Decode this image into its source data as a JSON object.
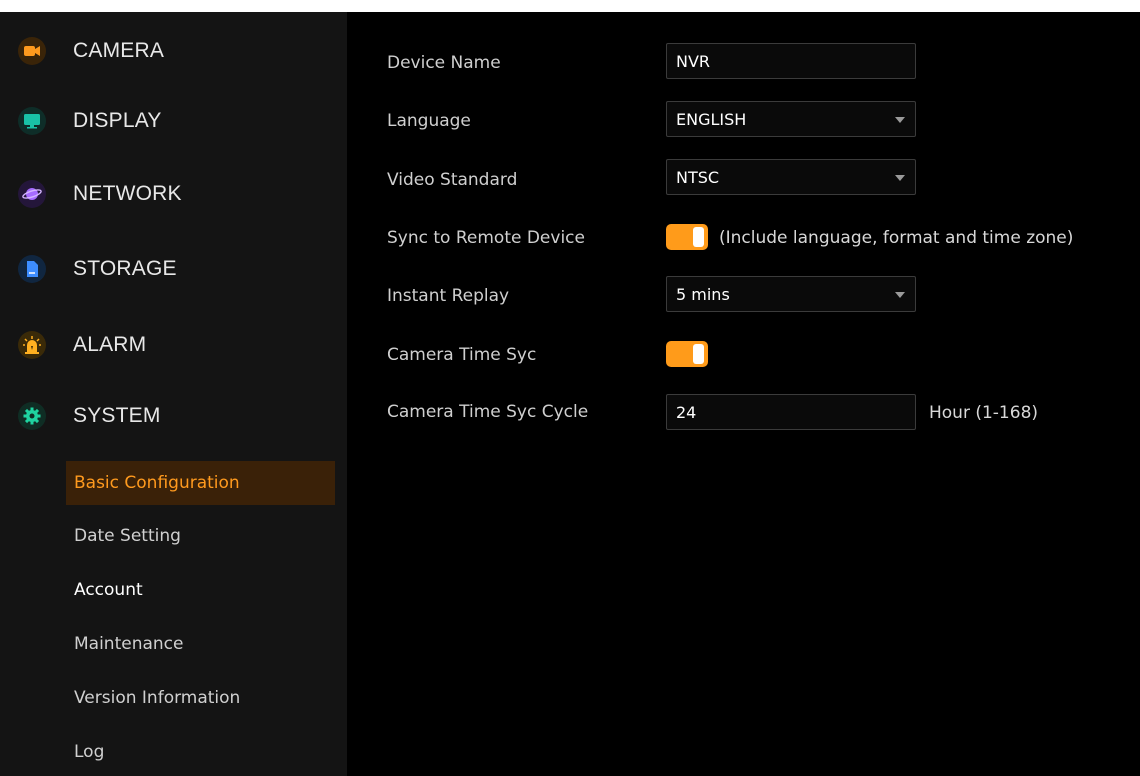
{
  "sidebar": {
    "menu": [
      {
        "label": "CAMERA",
        "icon": "camera-icon",
        "color": "#ff9a1e"
      },
      {
        "label": "DISPLAY",
        "icon": "display-icon",
        "color": "#19c2a7"
      },
      {
        "label": "NETWORK",
        "icon": "network-icon",
        "color": "#a66bff"
      },
      {
        "label": "STORAGE",
        "icon": "storage-icon",
        "color": "#3d8dff"
      },
      {
        "label": "ALARM",
        "icon": "alarm-icon",
        "color": "#ffb020"
      },
      {
        "label": "SYSTEM",
        "icon": "system-gear-icon",
        "color": "#1fd3a0"
      }
    ],
    "submenu": [
      {
        "label": "Basic Configuration",
        "active": true
      },
      {
        "label": "Date Setting"
      },
      {
        "label": "Account"
      },
      {
        "label": "Maintenance"
      },
      {
        "label": "Version Information"
      },
      {
        "label": "Log"
      }
    ]
  },
  "form": {
    "device_name": {
      "label": "Device Name",
      "value": "NVR"
    },
    "language": {
      "label": "Language",
      "value": "ENGLISH"
    },
    "video_standard": {
      "label": "Video Standard",
      "value": "NTSC"
    },
    "sync_remote": {
      "label": "Sync to Remote Device",
      "enabled": true,
      "note": "(Include language, format and time zone)"
    },
    "instant_replay": {
      "label": "Instant Replay",
      "value": "5 mins"
    },
    "camera_time_sync": {
      "label": "Camera Time Syc",
      "enabled": true
    },
    "camera_time_sync_cycle": {
      "label": "Camera Time Syc Cycle",
      "value": "24",
      "unit": "Hour (1-168)"
    }
  },
  "colors": {
    "accent": "#ff9b1a",
    "active_bg": "#3a2108",
    "sidebar_bg": "#141414"
  }
}
